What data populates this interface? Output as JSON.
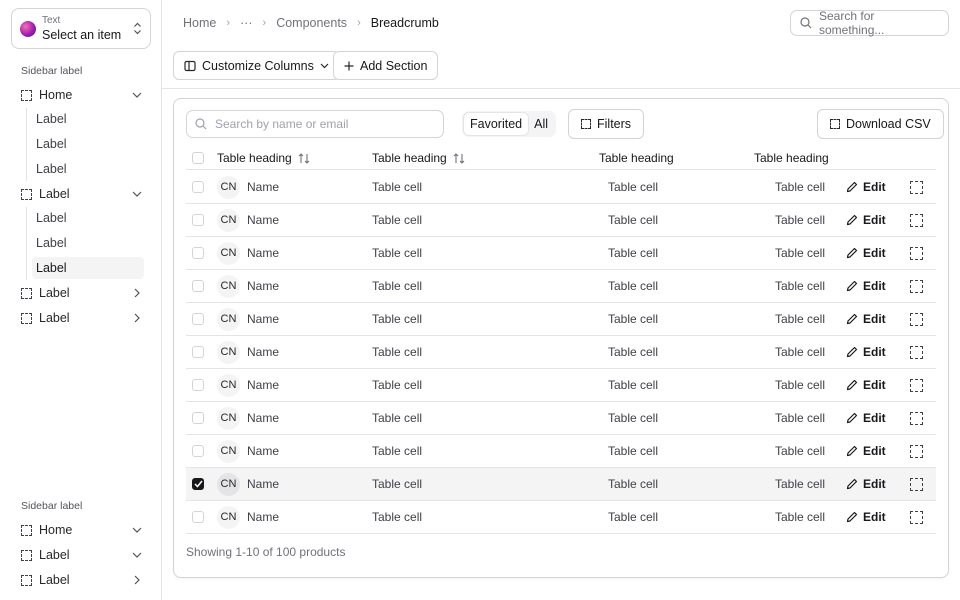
{
  "app": {
    "selector": {
      "small": "Text",
      "main": "Select an item"
    }
  },
  "sidebar": {
    "group1_label": "Sidebar label",
    "home": {
      "label": "Home",
      "subs": [
        "Label",
        "Label",
        "Label"
      ]
    },
    "label1": {
      "label": "Label",
      "subs": [
        "Label",
        "Label",
        "Label"
      ]
    },
    "label2": {
      "label": "Label"
    },
    "label3": {
      "label": "Label"
    },
    "group2_label": "Sidebar label",
    "bottom": [
      {
        "label": "Home"
      },
      {
        "label": "Label"
      },
      {
        "label": "Label"
      }
    ]
  },
  "breadcrumb": {
    "home": "Home",
    "ellipsis": "···",
    "components": "Components",
    "current": "Breadcrumb"
  },
  "top_search": {
    "placeholder": "Search for something..."
  },
  "toolbar": {
    "customize": "Customize Columns",
    "add_section": "Add Section"
  },
  "table_tools": {
    "search_placeholder": "Search by name or email",
    "segment": {
      "favorited": "Favorited",
      "all": "All"
    },
    "filters": "Filters",
    "download": "Download CSV"
  },
  "table": {
    "headings": [
      "Table heading",
      "Table heading",
      "Table heading",
      "Table heading"
    ],
    "rows": [
      {
        "avatar": "CN",
        "name": "Name",
        "c2": "Table cell",
        "c3": "Table cell",
        "c4": "Table cell",
        "edit": "Edit",
        "checked": false
      },
      {
        "avatar": "CN",
        "name": "Name",
        "c2": "Table cell",
        "c3": "Table cell",
        "c4": "Table cell",
        "edit": "Edit",
        "checked": false
      },
      {
        "avatar": "CN",
        "name": "Name",
        "c2": "Table cell",
        "c3": "Table cell",
        "c4": "Table cell",
        "edit": "Edit",
        "checked": false
      },
      {
        "avatar": "CN",
        "name": "Name",
        "c2": "Table cell",
        "c3": "Table cell",
        "c4": "Table cell",
        "edit": "Edit",
        "checked": false
      },
      {
        "avatar": "CN",
        "name": "Name",
        "c2": "Table cell",
        "c3": "Table cell",
        "c4": "Table cell",
        "edit": "Edit",
        "checked": false
      },
      {
        "avatar": "CN",
        "name": "Name",
        "c2": "Table cell",
        "c3": "Table cell",
        "c4": "Table cell",
        "edit": "Edit",
        "checked": false
      },
      {
        "avatar": "CN",
        "name": "Name",
        "c2": "Table cell",
        "c3": "Table cell",
        "c4": "Table cell",
        "edit": "Edit",
        "checked": false
      },
      {
        "avatar": "CN",
        "name": "Name",
        "c2": "Table cell",
        "c3": "Table cell",
        "c4": "Table cell",
        "edit": "Edit",
        "checked": false
      },
      {
        "avatar": "CN",
        "name": "Name",
        "c2": "Table cell",
        "c3": "Table cell",
        "c4": "Table cell",
        "edit": "Edit",
        "checked": false
      },
      {
        "avatar": "CN",
        "name": "Name",
        "c2": "Table cell",
        "c3": "Table cell",
        "c4": "Table cell",
        "edit": "Edit",
        "checked": true
      },
      {
        "avatar": "CN",
        "name": "Name",
        "c2": "Table cell",
        "c3": "Table cell",
        "c4": "Table cell",
        "edit": "Edit",
        "checked": false
      }
    ],
    "footer": "Showing 1-10 of 100 products"
  },
  "icons": {
    "selector": "chevrons-up-down-icon",
    "search": "search-icon",
    "columns": "columns-icon",
    "plus": "plus-icon",
    "sort": "sort-icon",
    "pencil": "pencil-icon"
  },
  "colors": {
    "selected_row": "#f4f4f5",
    "checkbox_checked": "#18181b",
    "border": "#d4d4d8"
  }
}
